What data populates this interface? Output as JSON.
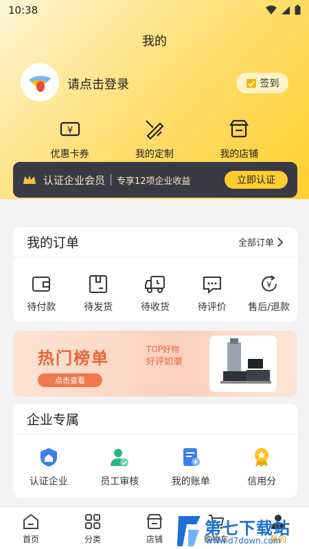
{
  "status": {
    "time": "10:38"
  },
  "header": {
    "title": "我的"
  },
  "user": {
    "login_prompt": "请点击登录",
    "signin_label": "签到"
  },
  "quick_actions": [
    {
      "label": "优惠卡券",
      "icon": "coupon-icon"
    },
    {
      "label": "我的定制",
      "icon": "customize-icon"
    },
    {
      "label": "我的店铺",
      "icon": "store-icon"
    }
  ],
  "vip": {
    "label": "认证企业会员",
    "desc": "专享12项企业收益",
    "button": "立即认证",
    "icon": "crown-icon"
  },
  "orders": {
    "title": "我的订单",
    "more": "全部订单",
    "items": [
      {
        "label": "待付款",
        "icon": "wallet-icon"
      },
      {
        "label": "待发货",
        "icon": "box-icon"
      },
      {
        "label": "待收货",
        "icon": "truck-icon"
      },
      {
        "label": "待评价",
        "icon": "comment-icon"
      },
      {
        "label": "售后/退款",
        "icon": "refund-icon"
      }
    ]
  },
  "banner": {
    "title": "热门榜单",
    "sub1": "TOP好物",
    "sub2": "好评如潮",
    "button": "点击查看"
  },
  "enterprise": {
    "title": "企业专属",
    "items": [
      {
        "label": "认证企业",
        "icon": "certified-home-icon"
      },
      {
        "label": "员工审核",
        "icon": "employee-review-icon"
      },
      {
        "label": "我的账单",
        "icon": "bill-icon"
      },
      {
        "label": "信用分",
        "icon": "credit-medal-icon"
      }
    ]
  },
  "tabbar": [
    {
      "label": "首页",
      "icon": "home-icon"
    },
    {
      "label": "分类",
      "icon": "category-icon"
    },
    {
      "label": "店铺",
      "icon": "shop-icon"
    },
    {
      "label": "购物车",
      "icon": "cart-icon"
    },
    {
      "label": "我的",
      "icon": "profile-icon"
    }
  ],
  "watermark": {
    "name": "第七下载站",
    "url": "www.d7down.com"
  },
  "colors": {
    "accent": "#ffcd2d",
    "vip_bg": "#3a3a44",
    "banner_accent": "#e8663a",
    "watermark": "#1d6fd6"
  }
}
